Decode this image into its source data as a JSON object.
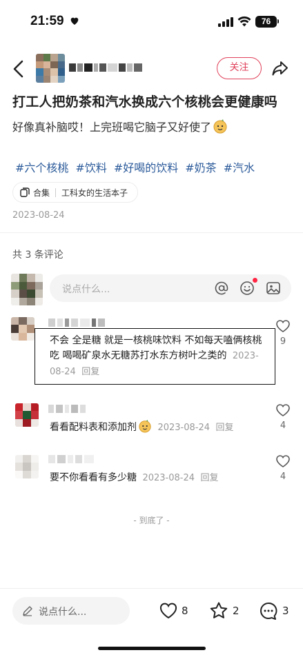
{
  "status_bar": {
    "time": "21:59",
    "battery": "76"
  },
  "header": {
    "follow_label": "关注"
  },
  "post": {
    "title": "打工人把奶茶和汽水换成六个核桃会更健康吗",
    "body": "好像真补脑哎！上完班喝它脑子又好使了",
    "tags": [
      "#六个核桃",
      "#饮料",
      "#好喝的饮料",
      "#奶茶",
      "#汽水"
    ],
    "collection_label": "合集",
    "collection_name": "工科女的生活本子",
    "date": "2023-08-24"
  },
  "comments_section": {
    "count_label": "共 3 条评论",
    "input_placeholder": "说点什么..."
  },
  "comments": [
    {
      "text": "不会 全是糖 就是一核桃味饮料 不如每天嗑俩核桃吃 喝喝矿泉水无糖苏打水东方树叶之类的",
      "date": "2023-08-24",
      "reply": "回复",
      "likes": "9"
    },
    {
      "text": "看看配料表和添加剂",
      "date": "2023-08-24",
      "reply": "回复",
      "likes": "4"
    },
    {
      "text": "要不你看看有多少糖",
      "date": "2023-08-24",
      "reply": "回复",
      "likes": "4"
    }
  ],
  "end_text": "- 到底了 -",
  "bottom_bar": {
    "input_placeholder": "说点什么...",
    "likes": "8",
    "collects": "2",
    "comments": "3"
  },
  "colors": {
    "accent": "#e0405a",
    "tag": "#2b5a9a",
    "notify_dot": "#ff2442"
  },
  "icons": [
    "heart-icon",
    "signal-icon",
    "wifi-icon",
    "back-icon",
    "share-icon",
    "collection-icon",
    "at-icon",
    "smile-icon",
    "image-icon",
    "pencil-icon",
    "star-icon",
    "comment-icon"
  ]
}
